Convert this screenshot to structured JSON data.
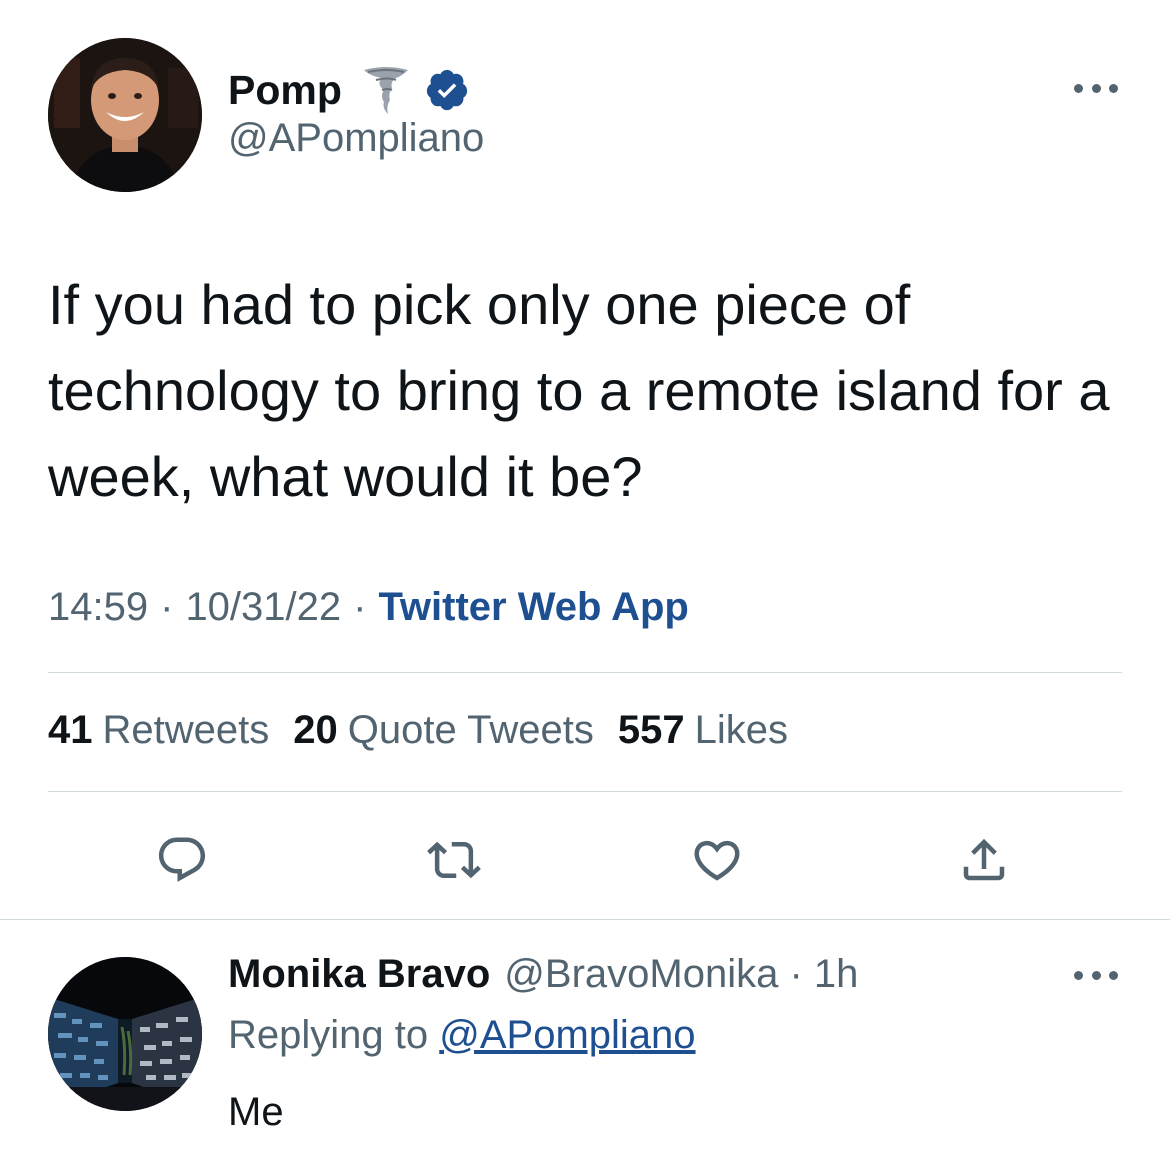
{
  "tweet": {
    "author_name": "Pomp",
    "author_handle": "@APompliano",
    "text": "If you had to pick only one piece of technology to bring to a remote island for a week, what would it be?",
    "time": "14:59",
    "date": "10/31/22",
    "separator": "·",
    "source": "Twitter Web App",
    "stats": {
      "retweets_count": "41",
      "retweets_label": "Retweets",
      "quotes_count": "20",
      "quotes_label": "Quote Tweets",
      "likes_count": "557",
      "likes_label": "Likes"
    },
    "icons": {
      "author_emoji": "tornado-icon",
      "verified": "verified-badge-icon",
      "more": "more-options-icon",
      "actions": [
        "reply-icon",
        "retweet-icon",
        "like-icon",
        "share-icon"
      ]
    }
  },
  "reply": {
    "author_name": "Monika Bravo",
    "author_handle": "@BravoMonika",
    "separator": " · ",
    "time": "1h",
    "replying_to_label": "Replying to",
    "replying_to_handle": "@APompliano",
    "text": "Me"
  },
  "colors": {
    "text_primary": "#0f1419",
    "text_secondary": "#536471",
    "link": "#1d4f91",
    "verified": "#1d4f91",
    "divider": "#cfd9de"
  }
}
